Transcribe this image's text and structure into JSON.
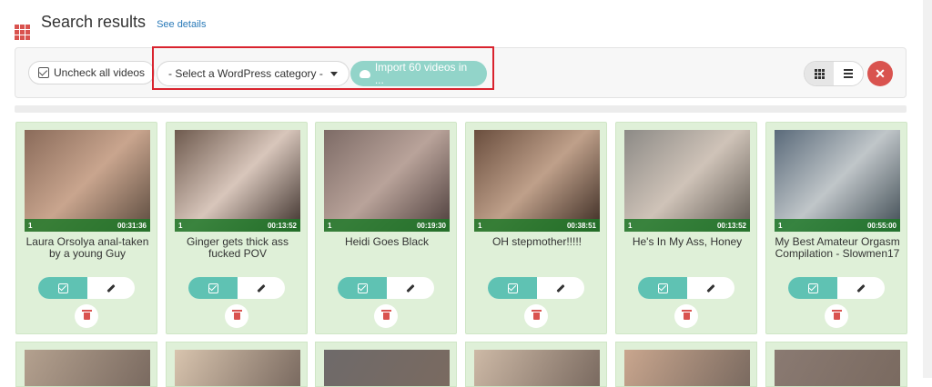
{
  "header": {
    "title": "Search results",
    "details_link": "See details"
  },
  "toolbar": {
    "uncheck_label": "Uncheck all videos",
    "category_select": "- Select a WordPress category -",
    "import_label": "Import 60 videos in ..."
  },
  "colors": {
    "card_bg": "#dff0d8",
    "accent": "#5fc2b3",
    "danger": "#d9534f",
    "highlight": "#d9232e"
  },
  "videos": [
    {
      "title": "Laura Orsolya anal-taken by a young Guy",
      "count": "1",
      "duration": "00:31:36"
    },
    {
      "title": "Ginger gets thick ass fucked POV",
      "count": "1",
      "duration": "00:13:52"
    },
    {
      "title": "Heidi Goes Black",
      "count": "1",
      "duration": "00:19:30"
    },
    {
      "title": "OH stepmother!!!!!",
      "count": "1",
      "duration": "00:38:51"
    },
    {
      "title": "He's In My Ass, Honey",
      "count": "1",
      "duration": "00:13:52"
    },
    {
      "title": "My Best Amateur Orgasm Compilation - Slowmen17",
      "count": "1",
      "duration": "00:55:00"
    }
  ]
}
